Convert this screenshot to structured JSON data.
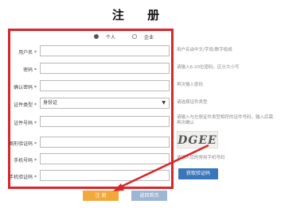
{
  "page": {
    "title": "注 册"
  },
  "user_type": {
    "options": [
      "个人",
      "企业"
    ],
    "selected": "个人"
  },
  "fields": [
    {
      "label": "用户名 *",
      "value": "",
      "hint": "用户名由中文/字母/数字组成"
    },
    {
      "label": "密码 *",
      "value": "",
      "hint": "请输入6-20位密码，区分大小写"
    },
    {
      "label": "确认密码 *",
      "value": "",
      "hint": "再次输入密码"
    },
    {
      "label": "证件类型 *",
      "value": "身份证",
      "hint": "请选择证件类型"
    },
    {
      "label": "证件号码 *",
      "value": "",
      "hint": "请输入与左侧证件类型相符的证件号码，输入后需再次确认"
    },
    {
      "label": "图形验证码 *",
      "value": "",
      "hint": ""
    },
    {
      "label": "手机号码 *",
      "value": "",
      "hint": "请输入您的常用手机号码"
    },
    {
      "label": "手机验证码 *",
      "value": "",
      "hint": ""
    }
  ],
  "captcha": {
    "text": "DGEE"
  },
  "buttons": {
    "sms_code": "获取验证码",
    "submit": "注 册",
    "reset": "返回首页"
  },
  "colors": {
    "frame": "#d9262b",
    "submit": "#f3a83b",
    "sms_button": "#3a76b9",
    "reset": "#9db6d4"
  }
}
